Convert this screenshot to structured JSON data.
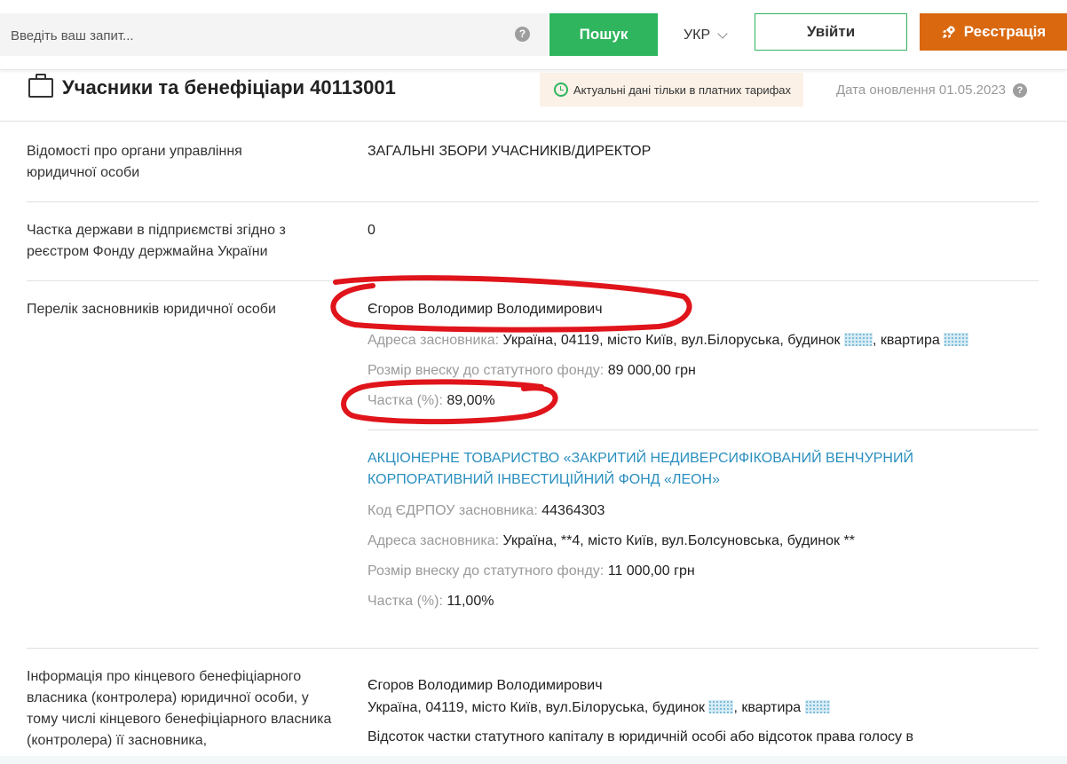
{
  "header": {
    "search_placeholder": "Введіть ваш запит...",
    "help_mark": "?",
    "search_button": "Пошук",
    "lang": "УКР",
    "login": "Увійти",
    "register": "Реєстрація"
  },
  "section": {
    "title": "Учасники та бенефіціари 40113001",
    "actual_notice": "Актуальні дані тільки в платних тарифах",
    "update_date": "Дата оновлення 01.05.2023",
    "help_mark": "?"
  },
  "rows": {
    "management": {
      "label": "Відомості про органи управління юридичної особи",
      "value": "ЗАГАЛЬНІ ЗБОРИ УЧАСНИКІВ/ДИРЕКТОР"
    },
    "state_share": {
      "label": "Частка держави в підприємстві згідно з реєстром Фонду держмайна України",
      "value": "0"
    },
    "founders": {
      "label": "Перелік засновників юридичної особи",
      "founder1": {
        "name": "Єгоров Володимир Володимирович",
        "address_label": "Адреса засновника:",
        "address_value": "Україна, 04119, місто Київ, вул.Білоруська, будинок",
        "address_apartment": "квартира",
        "contribution_label": "Розмір внеску до статутного фонду:",
        "contribution_value": "89 000,00 грн",
        "share_label": "Частка (%):",
        "share_value": "89,00%"
      },
      "founder2": {
        "name": "АКЦІОНЕРНЕ ТОВАРИСТВО «ЗАКРИТИЙ НЕДИВЕРСИФІКОВАНИЙ ВЕНЧУРНИЙ КОРПОРАТИВНИЙ ІНВЕСТИЦІЙНИЙ ФОНД «ЛЕОН»",
        "code_label": "Код ЄДРПОУ засновника:",
        "code_value": "44364303",
        "address_label": "Адреса засновника:",
        "address_value": "Україна, **4, місто Київ, вул.Болсуновська, будинок **",
        "contribution_label": "Розмір внеску до статутного фонду:",
        "contribution_value": "11 000,00 грн",
        "share_label": "Частка (%):",
        "share_value": "11,00%"
      }
    },
    "beneficiary": {
      "label": "Інформація про кінцевого бенефіціарного власника (контролера) юридичної особи, у тому числі кінцевого бенефіціарного власника (контролера) її засновника,",
      "name": "Єгоров Володимир Володимирович",
      "address": "Україна, 04119, місто Київ, вул.Білоруська, будинок",
      "apartment": "квартира",
      "share_note": "Відсоток частки статутного капіталу в юридичній особі або відсоток права голосу в"
    }
  },
  "colors": {
    "search_button": "#2fb55e",
    "register_button": "#d9680f",
    "link": "#2a8fbf",
    "annotation": "#e0141b"
  }
}
